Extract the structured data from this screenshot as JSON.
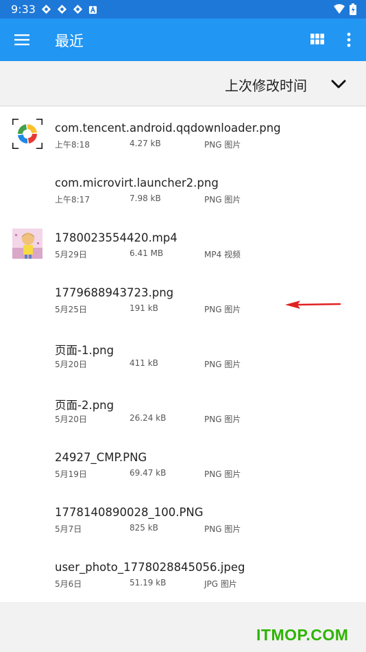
{
  "status_bar": {
    "time": "9:33"
  },
  "app_bar": {
    "title": "最近"
  },
  "sort_bar": {
    "label": "上次修改时间"
  },
  "files": [
    {
      "name": "com.tencent.android.qqdownloader.png",
      "date": "上午8:18",
      "size": "4.27 kB",
      "type": "PNG 图片",
      "thumb": "qqdownloader-logo"
    },
    {
      "name": "com.microvirt.launcher2.png",
      "date": "上午8:17",
      "size": "7.98 kB",
      "type": "PNG 图片",
      "thumb": ""
    },
    {
      "name": "1780023554420.mp4",
      "date": "5月29日",
      "size": "6.41 MB",
      "type": "MP4 视频",
      "thumb": "video-frame"
    },
    {
      "name": "1779688943723.png",
      "date": "5月25日",
      "size": "191 kB",
      "type": "PNG 图片",
      "thumb": ""
    },
    {
      "name": "页面-1.png",
      "date": "5月20日",
      "size": "411 kB",
      "type": "PNG 图片",
      "thumb": ""
    },
    {
      "name": "页面-2.png",
      "date": "5月20日",
      "size": "26.24 kB",
      "type": "PNG 图片",
      "thumb": ""
    },
    {
      "name": "24927_CMP.PNG",
      "date": "5月19日",
      "size": "69.47 kB",
      "type": "PNG 图片",
      "thumb": ""
    },
    {
      "name": "1778140890028_100.PNG",
      "date": "5月7日",
      "size": "825 kB",
      "type": "PNG 图片",
      "thumb": ""
    },
    {
      "name": "user_photo_1778028845056.jpeg",
      "date": "5月6日",
      "size": "51.19 kB",
      "type": "JPG 图片",
      "thumb": ""
    }
  ],
  "watermark": "ITMOP.COM",
  "colors": {
    "status_bar": "#1e78d8",
    "app_bar": "#2196f3",
    "annotation_arrow": "#e02020",
    "watermark": "#2db400"
  }
}
